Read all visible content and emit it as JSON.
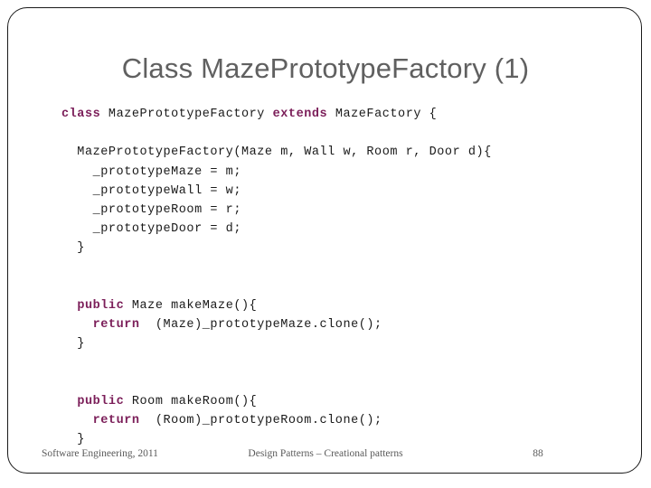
{
  "slide": {
    "title": "Class MazePrototypeFactory (1)",
    "page_number": "88",
    "accent_keyword_color": "#7b1e59",
    "title_color": "#606060",
    "code_color": "#1a1a1a",
    "border_color": "#1a1a1a",
    "background_color": "#ffffff"
  },
  "code": {
    "lines": [
      {
        "indent": 0,
        "segments": [
          {
            "text": "class ",
            "kind": "keyword"
          },
          {
            "text": "MazePrototypeFactory ",
            "kind": "plain"
          },
          {
            "text": "extends ",
            "kind": "keyword"
          },
          {
            "text": "MazeFactory {",
            "kind": "plain"
          }
        ]
      },
      {
        "indent": 0,
        "segments": []
      },
      {
        "indent": 0,
        "segments": [
          {
            "text": "  MazePrototypeFactory(Maze m, Wall w, Room r, Door d){",
            "kind": "plain"
          }
        ]
      },
      {
        "indent": 0,
        "segments": [
          {
            "text": "    _prototypeMaze = m;",
            "kind": "plain"
          }
        ]
      },
      {
        "indent": 0,
        "segments": [
          {
            "text": "    _prototypeWall = w;",
            "kind": "plain"
          }
        ]
      },
      {
        "indent": 0,
        "segments": [
          {
            "text": "    _prototypeRoom = r;",
            "kind": "plain"
          }
        ]
      },
      {
        "indent": 0,
        "segments": [
          {
            "text": "    _prototypeDoor = d;",
            "kind": "plain"
          }
        ]
      },
      {
        "indent": 0,
        "segments": [
          {
            "text": "  }",
            "kind": "plain"
          }
        ]
      },
      {
        "indent": 0,
        "segments": []
      },
      {
        "indent": 0,
        "segments": []
      },
      {
        "indent": 0,
        "segments": [
          {
            "text": "  ",
            "kind": "plain"
          },
          {
            "text": "public ",
            "kind": "keyword"
          },
          {
            "text": "Maze makeMaze(){",
            "kind": "plain"
          }
        ]
      },
      {
        "indent": 0,
        "segments": [
          {
            "text": "    ",
            "kind": "plain"
          },
          {
            "text": "return ",
            "kind": "keyword"
          },
          {
            "text": " (Maze)_prototypeMaze.clone();",
            "kind": "plain"
          }
        ]
      },
      {
        "indent": 0,
        "segments": [
          {
            "text": "  }",
            "kind": "plain"
          }
        ]
      },
      {
        "indent": 0,
        "segments": []
      },
      {
        "indent": 0,
        "segments": []
      },
      {
        "indent": 0,
        "segments": [
          {
            "text": "  ",
            "kind": "plain"
          },
          {
            "text": "public ",
            "kind": "keyword"
          },
          {
            "text": "Room makeRoom(){",
            "kind": "plain"
          }
        ]
      },
      {
        "indent": 0,
        "segments": [
          {
            "text": "    ",
            "kind": "plain"
          },
          {
            "text": "return ",
            "kind": "keyword"
          },
          {
            "text": " (Room)_prototypeRoom.clone();",
            "kind": "plain"
          }
        ]
      },
      {
        "indent": 0,
        "segments": [
          {
            "text": "  }",
            "kind": "plain"
          }
        ]
      }
    ]
  },
  "footer": {
    "left": "Software Engineering, 2011",
    "center": "Design Patterns – Creational patterns",
    "right": "88"
  }
}
